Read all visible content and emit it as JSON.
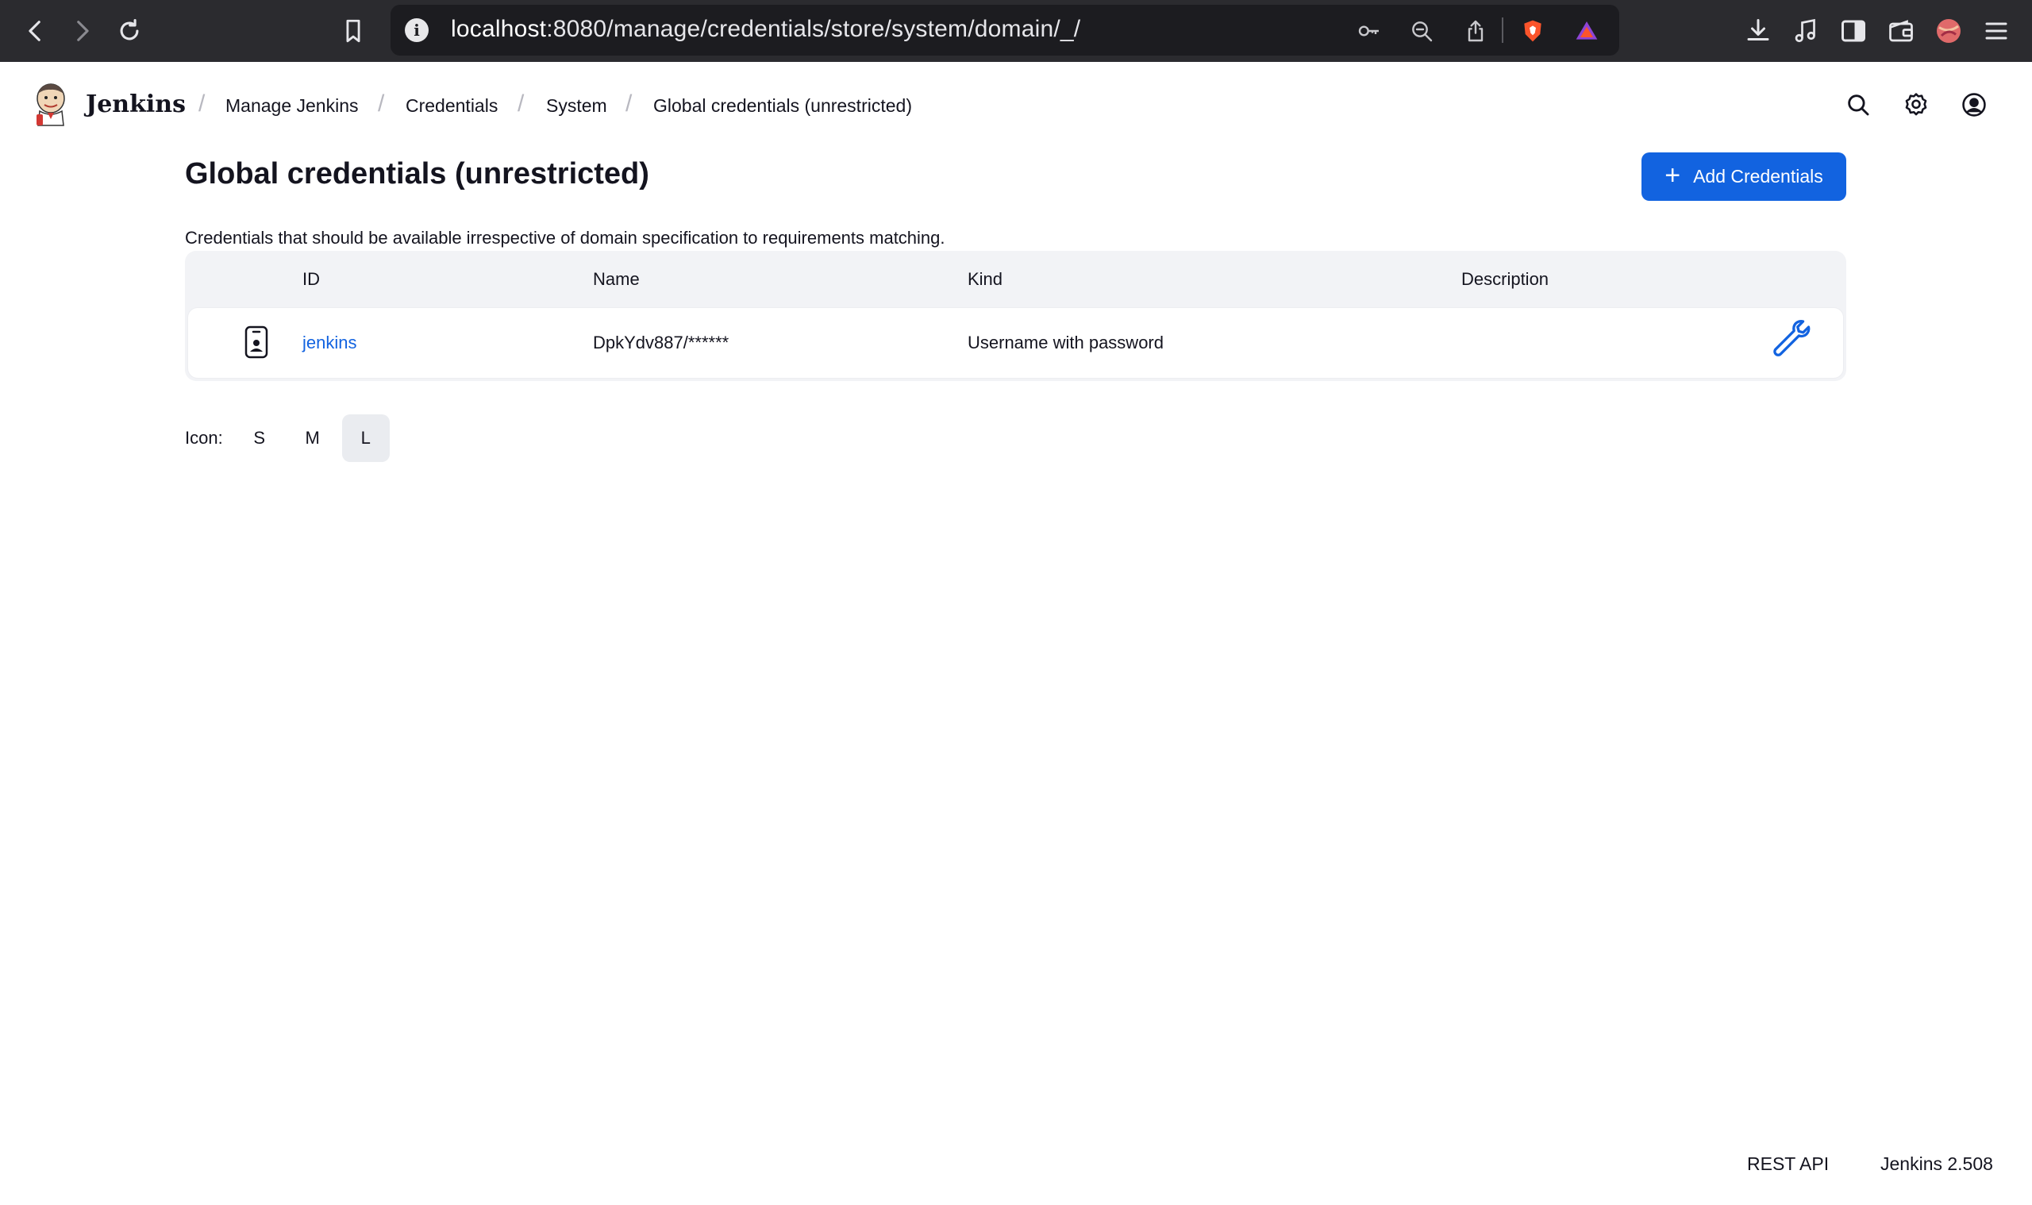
{
  "browser": {
    "url_host": "localhost",
    "url_rest": ":8080/manage/credentials/store/system/domain/_/"
  },
  "header": {
    "brand": "Jenkins",
    "breadcrumbs": [
      "Manage Jenkins",
      "Credentials",
      "System",
      "Global credentials (unrestricted)"
    ],
    "separator": "/"
  },
  "main": {
    "title": "Global credentials (unrestricted)",
    "add_button_label": "Add Credentials",
    "description": "Credentials that should be available irrespective of domain specification to requirements matching."
  },
  "table": {
    "columns": [
      "ID",
      "Name",
      "Kind",
      "Description"
    ],
    "rows": [
      {
        "id": "jenkins",
        "name": "DpkYdv887/******",
        "kind": "Username with password",
        "description": ""
      }
    ]
  },
  "icon_size": {
    "label": "Icon:",
    "options": [
      "S",
      "M",
      "L"
    ],
    "selected": "L"
  },
  "footer": {
    "rest_api": "REST API",
    "version": "Jenkins 2.508"
  },
  "colors": {
    "accent": "#1263e0",
    "browser_chrome": "#2b2b2f",
    "table_bg": "#f2f3f6"
  }
}
